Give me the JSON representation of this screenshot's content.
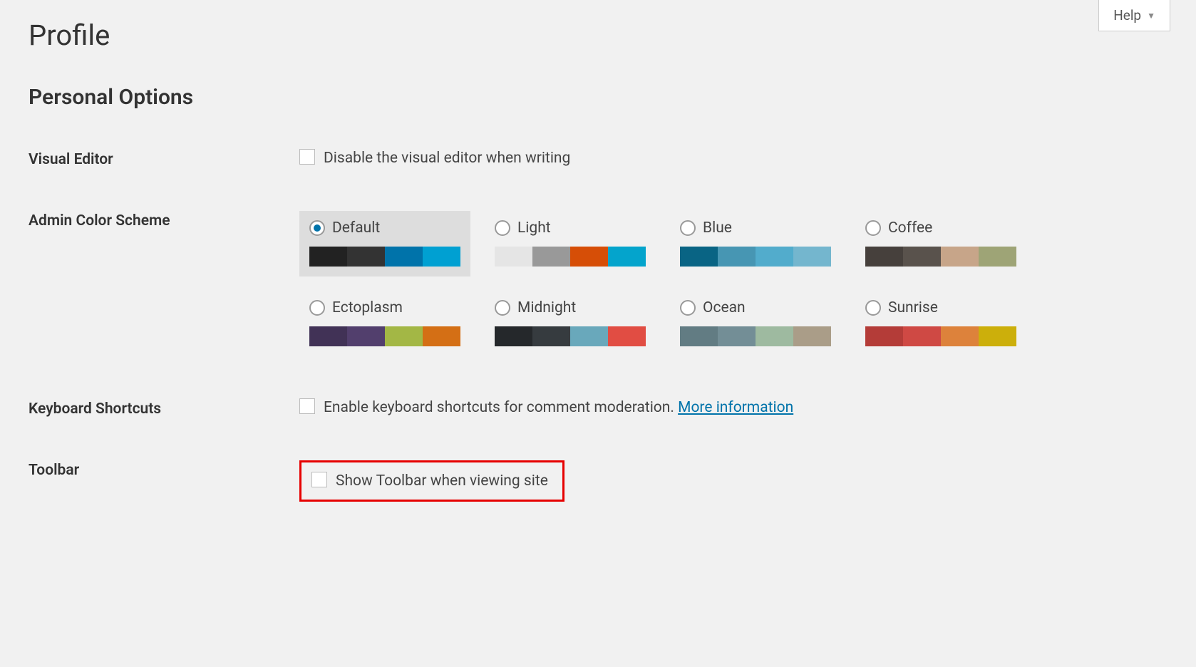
{
  "help_label": "Help",
  "page_title": "Profile",
  "section_title": "Personal Options",
  "visual_editor": {
    "label": "Visual Editor",
    "checkbox_label": "Disable the visual editor when writing"
  },
  "color_scheme": {
    "label": "Admin Color Scheme",
    "selected": "Default",
    "options": [
      {
        "name": "Default",
        "colors": [
          "#222222",
          "#333333",
          "#0073aa",
          "#00a0d2"
        ]
      },
      {
        "name": "Light",
        "colors": [
          "#e5e5e5",
          "#999999",
          "#d64e07",
          "#04a4cc"
        ]
      },
      {
        "name": "Blue",
        "colors": [
          "#096484",
          "#4796b3",
          "#52accc",
          "#74b6ce"
        ]
      },
      {
        "name": "Coffee",
        "colors": [
          "#46403c",
          "#59524c",
          "#c7a589",
          "#9ea476"
        ]
      },
      {
        "name": "Ectoplasm",
        "colors": [
          "#413256",
          "#523f6d",
          "#a3b745",
          "#d46f15"
        ]
      },
      {
        "name": "Midnight",
        "colors": [
          "#25282b",
          "#363b3f",
          "#69a8bb",
          "#e14d43"
        ]
      },
      {
        "name": "Ocean",
        "colors": [
          "#627c83",
          "#738e96",
          "#9ebaa0",
          "#aa9d88"
        ]
      },
      {
        "name": "Sunrise",
        "colors": [
          "#b43c38",
          "#cf4944",
          "#dd823b",
          "#ccaf0b"
        ]
      }
    ]
  },
  "keyboard_shortcuts": {
    "label": "Keyboard Shortcuts",
    "checkbox_label": "Enable keyboard shortcuts for comment moderation. ",
    "more_link": "More information"
  },
  "toolbar": {
    "label": "Toolbar",
    "checkbox_label": "Show Toolbar when viewing site"
  }
}
